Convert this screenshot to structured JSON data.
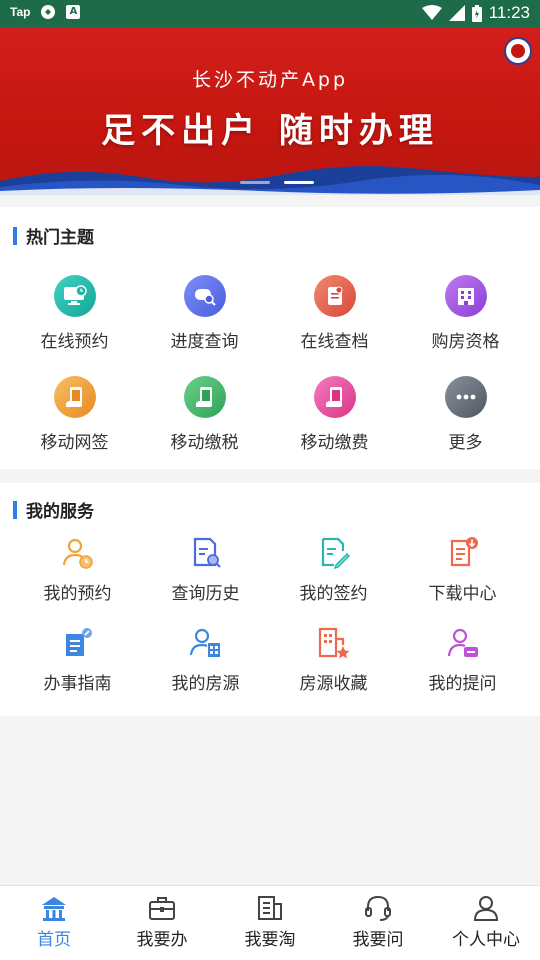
{
  "status_bar": {
    "app_label": "Tap",
    "a_icon_label": "A",
    "time": "11:23"
  },
  "banner": {
    "subtitle": "长沙不动产App",
    "headline": "足不出户  随时办理",
    "slides_total": 2,
    "active_slide": 2
  },
  "hot_topics": {
    "title": "热门主题",
    "items": [
      {
        "label": "在线预约",
        "icon": "monitor-clock-icon",
        "color": "#1fb5a8"
      },
      {
        "label": "进度查询",
        "icon": "search-card-icon",
        "color": "#5a6fe8"
      },
      {
        "label": "在线查档",
        "icon": "document-icon",
        "color": "#e4614c"
      },
      {
        "label": "购房资格",
        "icon": "building-icon",
        "color": "#a159e3"
      },
      {
        "label": "移动网签",
        "icon": "mobile-sign-icon",
        "color": "#f0a23c"
      },
      {
        "label": "移动缴税",
        "icon": "mobile-tax-icon",
        "color": "#3fb167"
      },
      {
        "label": "移动缴费",
        "icon": "mobile-pay-icon",
        "color": "#e4479a"
      },
      {
        "label": "更多",
        "icon": "more-icon",
        "color": "#646c78"
      }
    ]
  },
  "my_services": {
    "title": "我的服务",
    "items": [
      {
        "label": "我的预约",
        "icon": "user-clock-icon",
        "color": "#f0a23c"
      },
      {
        "label": "查询历史",
        "icon": "doc-search-icon",
        "color": "#4c6ae3"
      },
      {
        "label": "我的签约",
        "icon": "doc-sign-icon",
        "color": "#27b7b0"
      },
      {
        "label": "下载中心",
        "icon": "doc-download-icon",
        "color": "#ee6a4e"
      },
      {
        "label": "办事指南",
        "icon": "guide-icon",
        "color": "#3d87e3"
      },
      {
        "label": "我的房源",
        "icon": "user-building-icon",
        "color": "#3d87e3"
      },
      {
        "label": "房源收藏",
        "icon": "building-star-icon",
        "color": "#ee6a4e"
      },
      {
        "label": "我的提问",
        "icon": "user-question-icon",
        "color": "#c150d9"
      }
    ]
  },
  "tabbar": {
    "active_color": "#3a86e0",
    "tabs": [
      {
        "label": "首页",
        "icon": "home-icon",
        "active": true
      },
      {
        "label": "我要办",
        "icon": "briefcase-icon",
        "active": false
      },
      {
        "label": "我要淘",
        "icon": "building-list-icon",
        "active": false
      },
      {
        "label": "我要问",
        "icon": "headset-icon",
        "active": false
      },
      {
        "label": "个人中心",
        "icon": "person-icon",
        "active": false
      }
    ]
  }
}
